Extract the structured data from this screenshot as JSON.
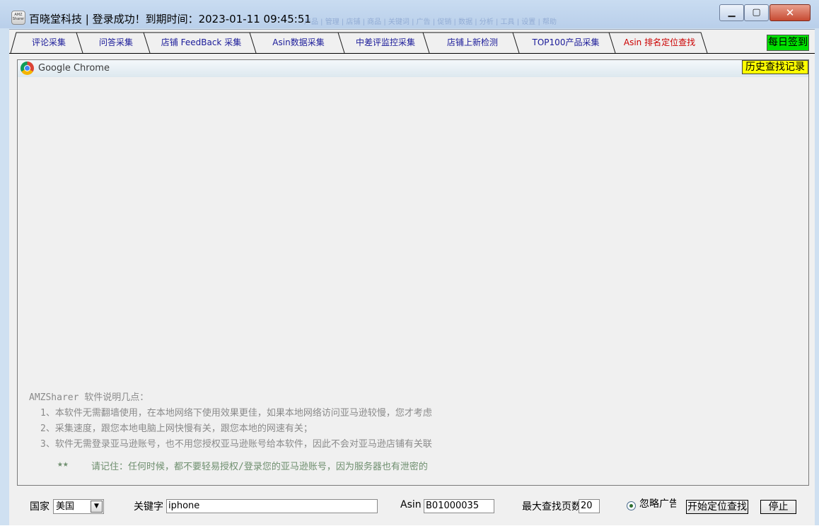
{
  "window": {
    "title": "百晓堂科技 | 登录成功！到期时间：2023-01-11 09:45:51",
    "icon_text": "AMZ Sharer",
    "ghost_strip": "产品 | 管理 | 店铺 | 商品 | 关键词 | 广告 | 促销 | 数据 | 分析 | 工具 | 设置 | 帮助"
  },
  "tabs": [
    {
      "label": "评论采集",
      "active": false
    },
    {
      "label": "问答采集",
      "active": false
    },
    {
      "label": "店铺 FeedBack 采集",
      "active": false
    },
    {
      "label": "Asin数据采集",
      "active": false
    },
    {
      "label": "中差评监控采集",
      "active": false
    },
    {
      "label": "店铺上新检测",
      "active": false
    },
    {
      "label": "TOP100产品采集",
      "active": false
    },
    {
      "label": "Asin 排名定位查找",
      "active": true
    }
  ],
  "signin_label": "每日签到",
  "browser": {
    "name": "Google Chrome",
    "history_label": "历史查找记录"
  },
  "notes": {
    "heading": "AMZSharer 软件说明几点：",
    "items": [
      "1、本软件无需翻墙使用，在本地网络下使用效果更佳，如果本地网络访问亚马逊较慢，您才考虑",
      "2、采集速度，跟您本地电脑上网快慢有关，跟您本地的网速有关；",
      "3、软件无需登录亚马逊账号，也不用您授权亚马逊账号给本软件，因此不会对亚马逊店铺有关联"
    ],
    "warning_stars": "★★",
    "warning": "请记住：任何时候，都不要轻易授权/登录您的亚马逊账号，因为服务器也有泄密的"
  },
  "controls": {
    "country_label": "国家",
    "country_value": "美国",
    "keyword_label": "关键字",
    "keyword_value": "iphone",
    "asin_label": "Asin",
    "asin_value": "B01000035",
    "maxpage_label": "最大查找页数",
    "maxpage_value": "20",
    "ignore_ads_label": "忽略广告",
    "start_label": "开始定位查找",
    "stop_label": "停止"
  }
}
